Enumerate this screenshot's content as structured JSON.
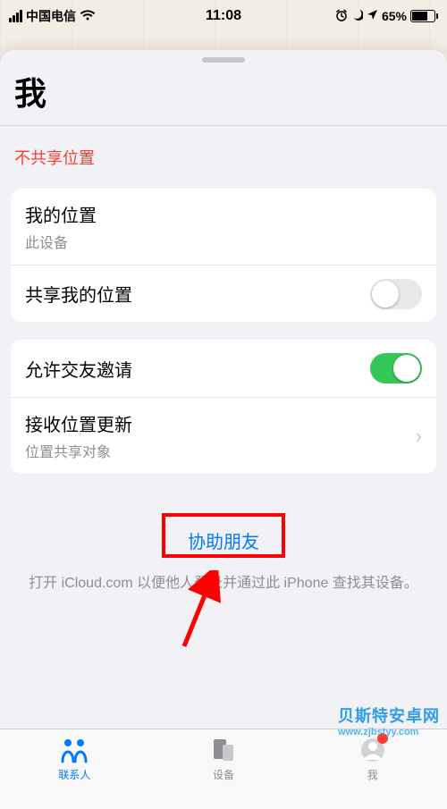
{
  "status": {
    "carrier": "中国电信",
    "time": "11:08",
    "battery_pct": "65%"
  },
  "sheet": {
    "title": "我",
    "warning": "不共享位置"
  },
  "group1": {
    "my_location_label": "我的位置",
    "my_location_sub": "此设备",
    "share_location_label": "共享我的位置",
    "share_location_on": false
  },
  "group2": {
    "allow_friend_label": "允许交友邀请",
    "allow_friend_on": true,
    "receive_updates_label": "接收位置更新",
    "receive_updates_sub": "位置共享对象"
  },
  "help": {
    "link": "协助朋友",
    "desc": "打开 iCloud.com 以便他人登录并通过此 iPhone 查找其设备。"
  },
  "tabs": {
    "people": "联系人",
    "devices": "设备",
    "me": "我"
  },
  "watermark": {
    "line1": "贝斯特安卓网",
    "line2": "www.zjbstyy.com"
  }
}
